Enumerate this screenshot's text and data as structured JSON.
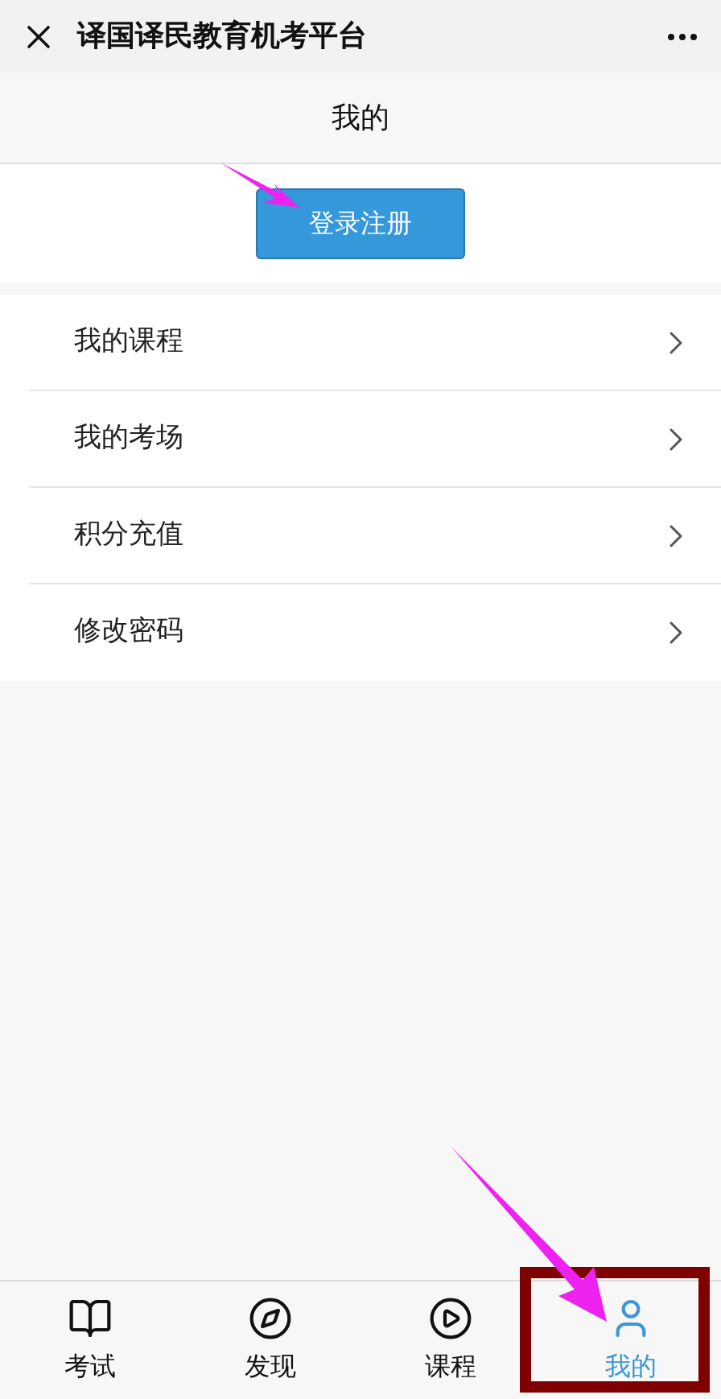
{
  "top_bar": {
    "title": "译国译民教育机考平台"
  },
  "header": {
    "title": "我的"
  },
  "login_button": "登录注册",
  "menu": [
    {
      "label": "我的课程"
    },
    {
      "label": "我的考场"
    },
    {
      "label": "积分充值"
    },
    {
      "label": "修改密码"
    }
  ],
  "tabs": [
    {
      "label": "考试",
      "kind": "book",
      "selected": false
    },
    {
      "label": "发现",
      "kind": "compass",
      "selected": false
    },
    {
      "label": "课程",
      "kind": "play",
      "selected": false
    },
    {
      "label": "我的",
      "kind": "user",
      "selected": true
    }
  ]
}
